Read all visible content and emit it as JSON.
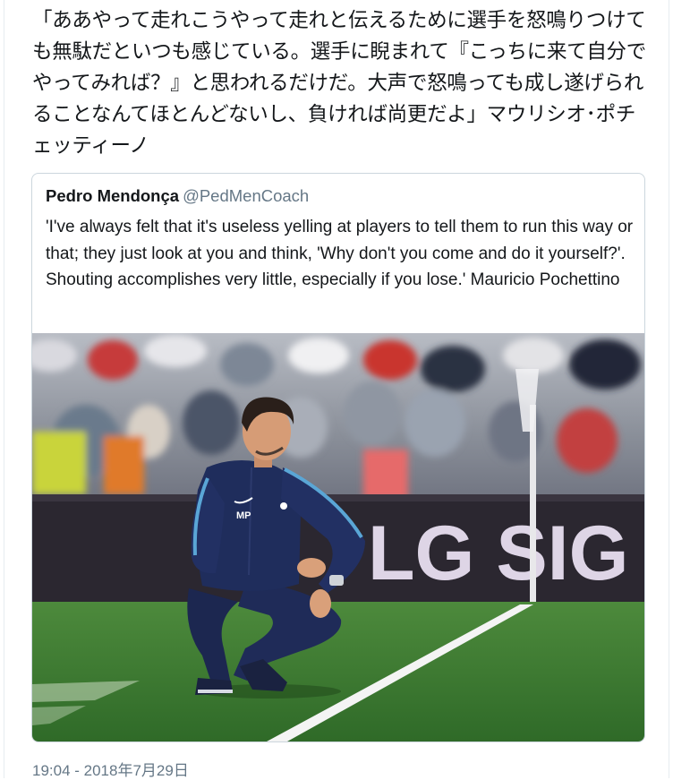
{
  "tweet": {
    "text": "「ああやって走れこうやって走れと伝えるために選手を怒鳴りつけても無駄だといつも感じている。選手に睨まれて『こっちに来て自分でやってみれば？』と思われるだけだ。大声で怒鳴っても成し遂げられることなんてほとんどないし、負ければ尚更だよ」マウリシオ･ポチェッティーノ",
    "timestamp": "19:04 - 2018年7月29日"
  },
  "quoted_tweet": {
    "name": "Pedro Mendonça",
    "handle": "@PedMenCoach",
    "text": "'I've always felt that it's useless yelling at players to tell them to run this way or that; they just look at you and think, 'Why don't you come and do it yourself?'. Shouting accomplishes very little, especially if you lose.' Mauricio Pochettino",
    "photo": {
      "board_text": "LG SIG",
      "jacket_initials": "MP"
    }
  },
  "colors": {
    "text": "#14171a",
    "secondary": "#657786",
    "border": "#ccd6dd",
    "pitch": "#3f7a32",
    "jacket": "#1f2d5c"
  }
}
